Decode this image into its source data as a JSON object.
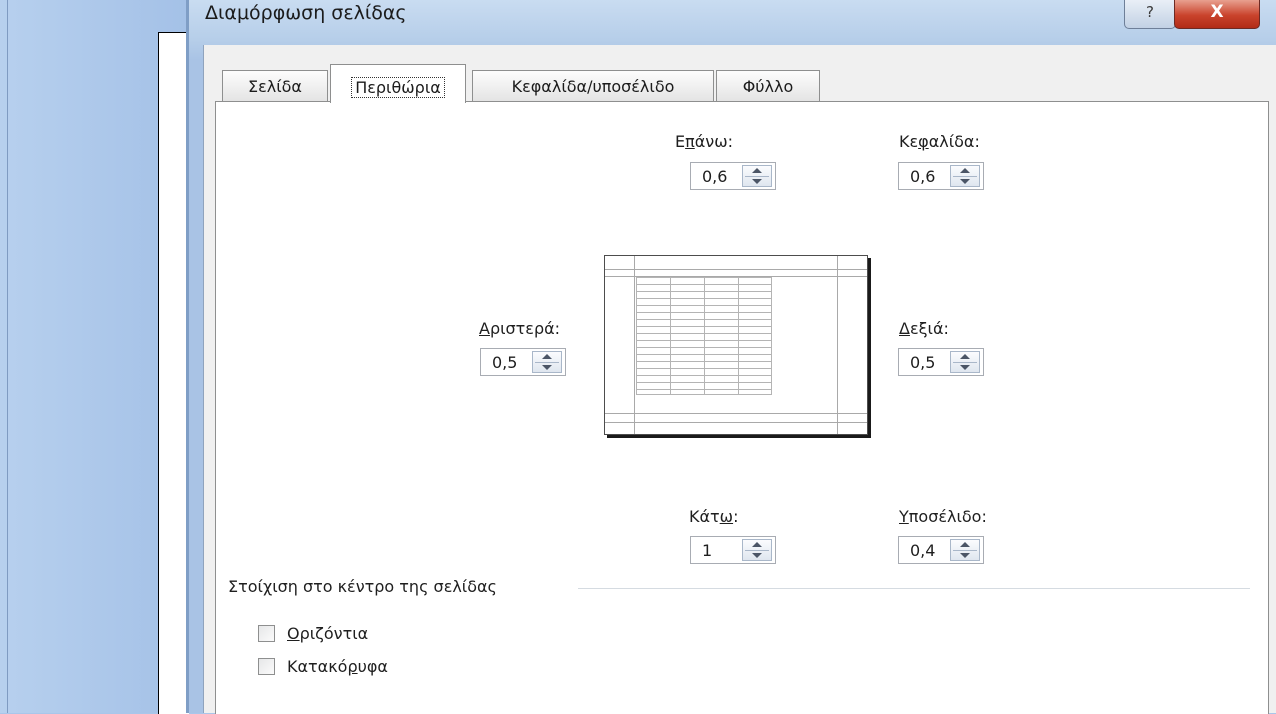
{
  "dialog": {
    "title": "Διαμόρφωση σελίδας",
    "help_label": "?",
    "close_label": "X"
  },
  "tabs": [
    {
      "label": "Σελίδα"
    },
    {
      "label": "Περιθώρια",
      "active": true
    },
    {
      "label": "Κεφαλίδα/υποσέλιδο"
    },
    {
      "label": "Φύλλο"
    }
  ],
  "margins": {
    "top": {
      "pre": "Ε",
      "key": "π",
      "post": "άνω:",
      "value": "0,6"
    },
    "header": {
      "pre": "Κε",
      "key": "φ",
      "post": "αλίδα:",
      "value": "0,6"
    },
    "left": {
      "pre": "",
      "key": "Α",
      "post": "ριστερά:",
      "value": "0,5"
    },
    "right": {
      "pre": "",
      "key": "Δ",
      "post": "εξιά:",
      "value": "0,5"
    },
    "bottom": {
      "pre": "Κάτ",
      "key": "ω",
      "post": ":",
      "value": "1"
    },
    "footer": {
      "pre": "",
      "key": "Υ",
      "post": "ποσέλιδο:",
      "value": "0,4"
    }
  },
  "center_group": {
    "title": "Στοίχιση στο κέντρο της σελίδας",
    "horizontal": {
      "pre": "",
      "key": "Ο",
      "post": "ριζόντια",
      "checked": false
    },
    "vertical": {
      "pre": "Κατακό",
      "key": "ρ",
      "post": "υφα",
      "checked": false
    }
  },
  "colors": {
    "accent": "#a9c6ea",
    "close": "#c9432c"
  }
}
